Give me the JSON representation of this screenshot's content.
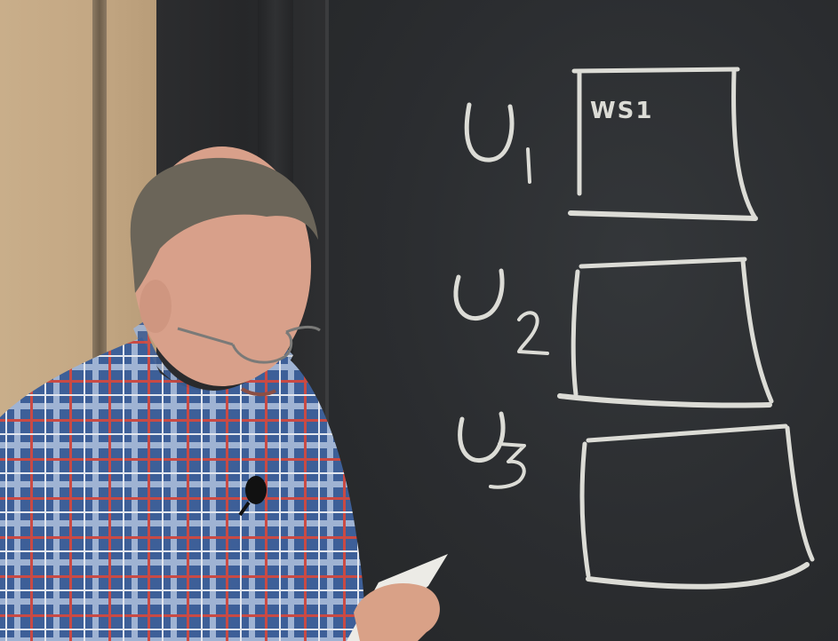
{
  "scene": {
    "description_free": true,
    "colors": {
      "chalk": "#dcdcd6",
      "board": "#2b2d30",
      "wall": "#c4a884",
      "shirt_blue": "#3b5f99",
      "shirt_red": "#c0413f"
    }
  },
  "board": {
    "box1_label": "WS1",
    "rows": [
      {
        "symbol": "U",
        "subscript": "1"
      },
      {
        "symbol": "U",
        "subscript": "2"
      },
      {
        "symbol": "U",
        "subscript": "3"
      }
    ]
  }
}
